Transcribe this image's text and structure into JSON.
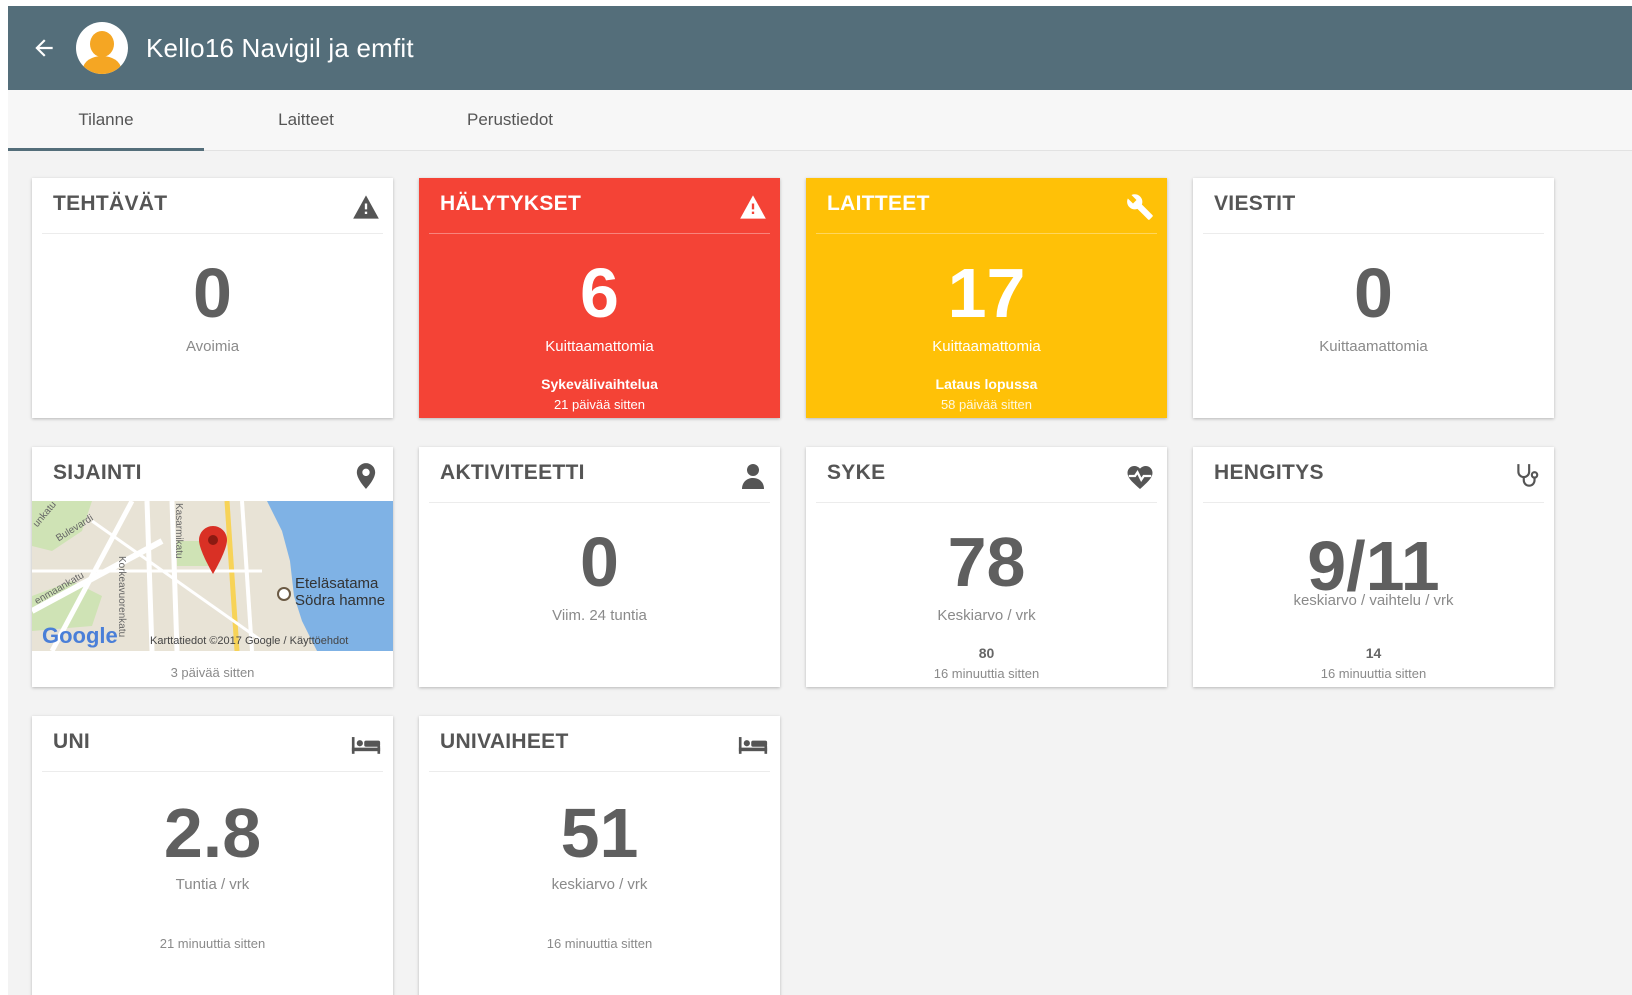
{
  "app": {
    "title": "Kello16 Navigil ja emfit",
    "back_icon": "arrow-left-icon",
    "avatar_icon": "person-avatar-icon"
  },
  "tabs": [
    {
      "label": "Tilanne",
      "active": true
    },
    {
      "label": "Laitteet",
      "active": false
    },
    {
      "label": "Perustiedot",
      "active": false
    }
  ],
  "colors": {
    "appbar": "#546e7a",
    "alert": "#f44336",
    "devices": "#ffc107"
  },
  "cards": {
    "tehtavat": {
      "title": "TEHTÄVÄT",
      "value": "0",
      "sub": "Avoimia",
      "icon": "warning-icon"
    },
    "halytykset": {
      "title": "HÄLYTYKSET",
      "value": "6",
      "sub": "Kuittaamattomia",
      "detail": "Sykevälivaihtelua",
      "time": "21 päivää sitten",
      "icon": "warning-icon"
    },
    "laitteet": {
      "title": "LAITTEET",
      "value": "17",
      "sub": "Kuittaamattomia",
      "detail": "Lataus lopussa",
      "time": "58 päivää sitten",
      "icon": "wrench-icon"
    },
    "viestit": {
      "title": "VIESTIT",
      "value": "0",
      "sub": "Kuittaamattomia"
    },
    "sijainti": {
      "title": "SIJAINTI",
      "icon": "location-pin-icon",
      "time": "3 päivää sitten",
      "map": {
        "place_line1": "Eteläsatama",
        "place_line2": "Södra hamne",
        "attribution": "Karttatiedot ©2017 Google",
        "terms": "Käyttöehdot",
        "logo": "Google",
        "streets": [
          "Bulevardi",
          "Korkeavuorenkatu",
          "Kasarmikatu",
          "enmaankatu",
          "unkatu"
        ]
      }
    },
    "aktiviteetti": {
      "title": "AKTIVITEETTI",
      "value": "0",
      "sub": "Viim. 24 tuntia",
      "icon": "person-icon"
    },
    "syke": {
      "title": "SYKE",
      "value": "78",
      "sub": "Keskiarvo / vrk",
      "detail": "80",
      "time": "16 minuuttia sitten",
      "icon": "heart-pulse-icon"
    },
    "hengitys": {
      "title": "HENGITYS",
      "value": "9/11",
      "sub": "keskiarvo / vaihtelu / vrk",
      "detail": "14",
      "time": "16 minuuttia sitten",
      "icon": "stethoscope-icon"
    },
    "uni": {
      "title": "UNI",
      "value": "2.8",
      "sub": "Tuntia / vrk",
      "time": "21 minuuttia sitten",
      "icon": "bed-icon"
    },
    "univaiheet": {
      "title": "UNIVAIHEET",
      "value": "51",
      "sub": "keskiarvo / vrk",
      "time": "16 minuuttia sitten",
      "icon": "bed-icon"
    }
  }
}
